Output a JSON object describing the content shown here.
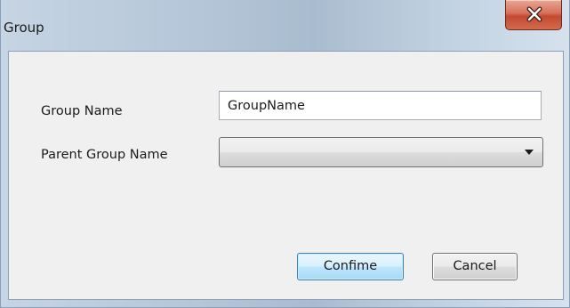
{
  "window": {
    "title": "Group"
  },
  "form": {
    "group_name_label": "Group Name",
    "group_name_value": "GroupName",
    "parent_group_label": "Parent Group Name",
    "parent_group_value": ""
  },
  "buttons": {
    "confirm_label": "Confime",
    "cancel_label": "Cancel"
  },
  "icons": {
    "close": "close-x-icon",
    "dropdown": "chevron-down-icon"
  },
  "colors": {
    "close_button": "#c24a30",
    "confirm_border": "#3c7fb1",
    "client_bg": "#f0f0f0"
  }
}
